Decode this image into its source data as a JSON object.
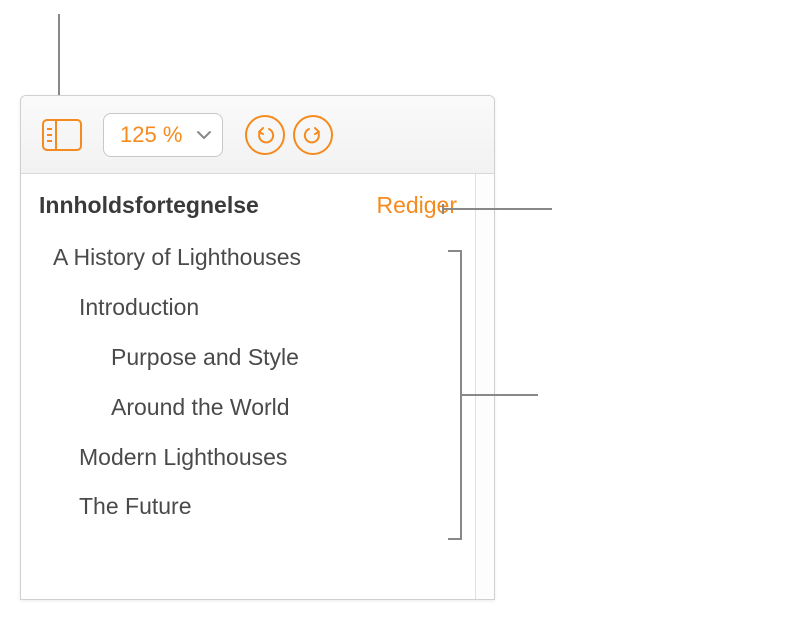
{
  "toolbar": {
    "zoom_value": "125 %"
  },
  "toc": {
    "title": "Innholdsfortegnelse",
    "edit_label": "Rediger",
    "items": [
      {
        "label": "A History of Lighthouses",
        "level": 1
      },
      {
        "label": "Introduction",
        "level": 2
      },
      {
        "label": "Purpose and Style",
        "level": 3
      },
      {
        "label": "Around the World",
        "level": 3
      },
      {
        "label": "Modern Lighthouses",
        "level": 2
      },
      {
        "label": "The Future",
        "level": 2
      }
    ]
  }
}
